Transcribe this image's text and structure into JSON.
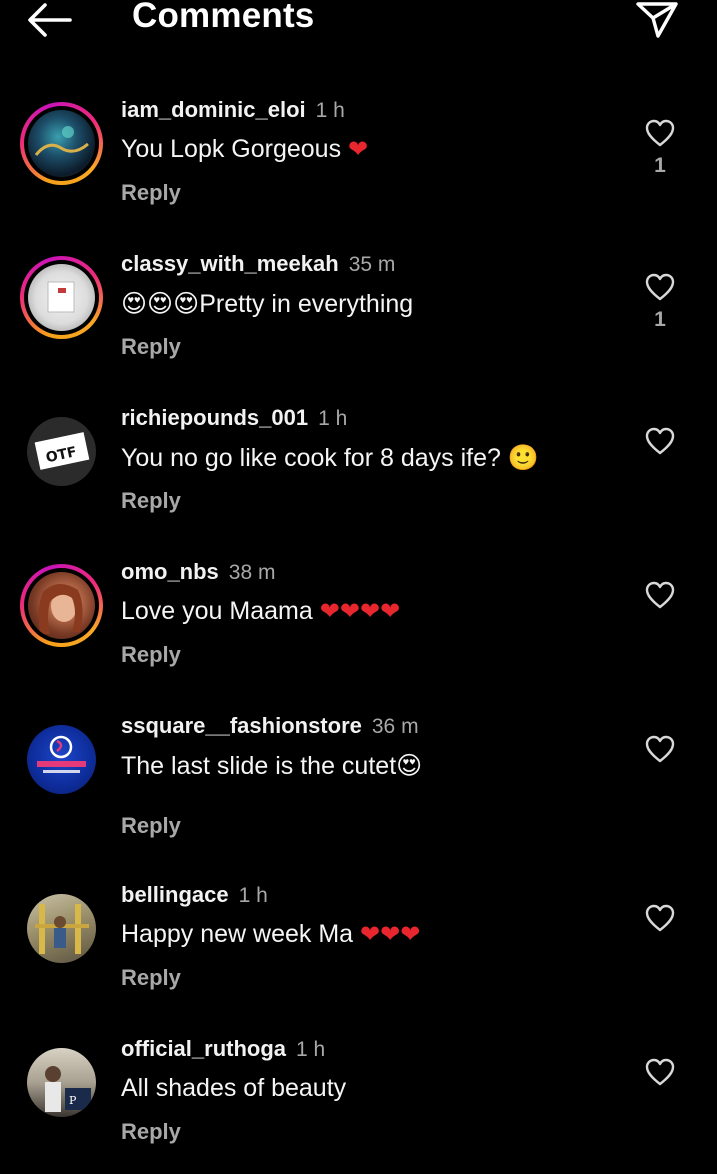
{
  "header": {
    "title": "Comments",
    "back_icon": "arrow-left-icon",
    "send_icon": "paper-plane-icon"
  },
  "colors": {
    "background": "#000000",
    "text": "#f5f5f5",
    "muted": "#a8a8a8",
    "heart_emoji": "#e8262e"
  },
  "comments": [
    {
      "username": "iam_dominic_eloi",
      "time": "1 h",
      "text": "You Lopk Gorgeous",
      "emoji": "❤",
      "reply": "Reply",
      "likes": "1",
      "avatar_ring": true
    },
    {
      "username": "classy_with_meekah",
      "time": "35 m",
      "prefix_emoji": "😍😍😍",
      "text": "Pretty in everything",
      "reply": "Reply",
      "likes": "1",
      "avatar_ring": true
    },
    {
      "username": "richiepounds_001",
      "time": "1 h",
      "text": "You no go like cook for 8 days ife?",
      "emoji": "🙂",
      "reply": "Reply",
      "likes": "",
      "avatar_ring": false
    },
    {
      "username": "omo_nbs",
      "time": "38 m",
      "text": "Love you Maama",
      "emoji": "❤❤❤❤",
      "reply": "Reply",
      "likes": "",
      "avatar_ring": true
    },
    {
      "username": "ssquare__fashionstore",
      "time": "36 m",
      "text": "The last slide is the cutet",
      "emoji": "😍",
      "reply": "Reply",
      "likes": "",
      "avatar_ring": false
    },
    {
      "username": "bellingace",
      "time": "1 h",
      "text": "Happy new week Ma",
      "emoji": "❤❤❤",
      "reply": "Reply",
      "likes": "",
      "avatar_ring": false
    },
    {
      "username": "official_ruthoga",
      "time": "1 h",
      "text": "All shades of beauty",
      "reply": "Reply",
      "likes": "",
      "avatar_ring": false
    }
  ]
}
